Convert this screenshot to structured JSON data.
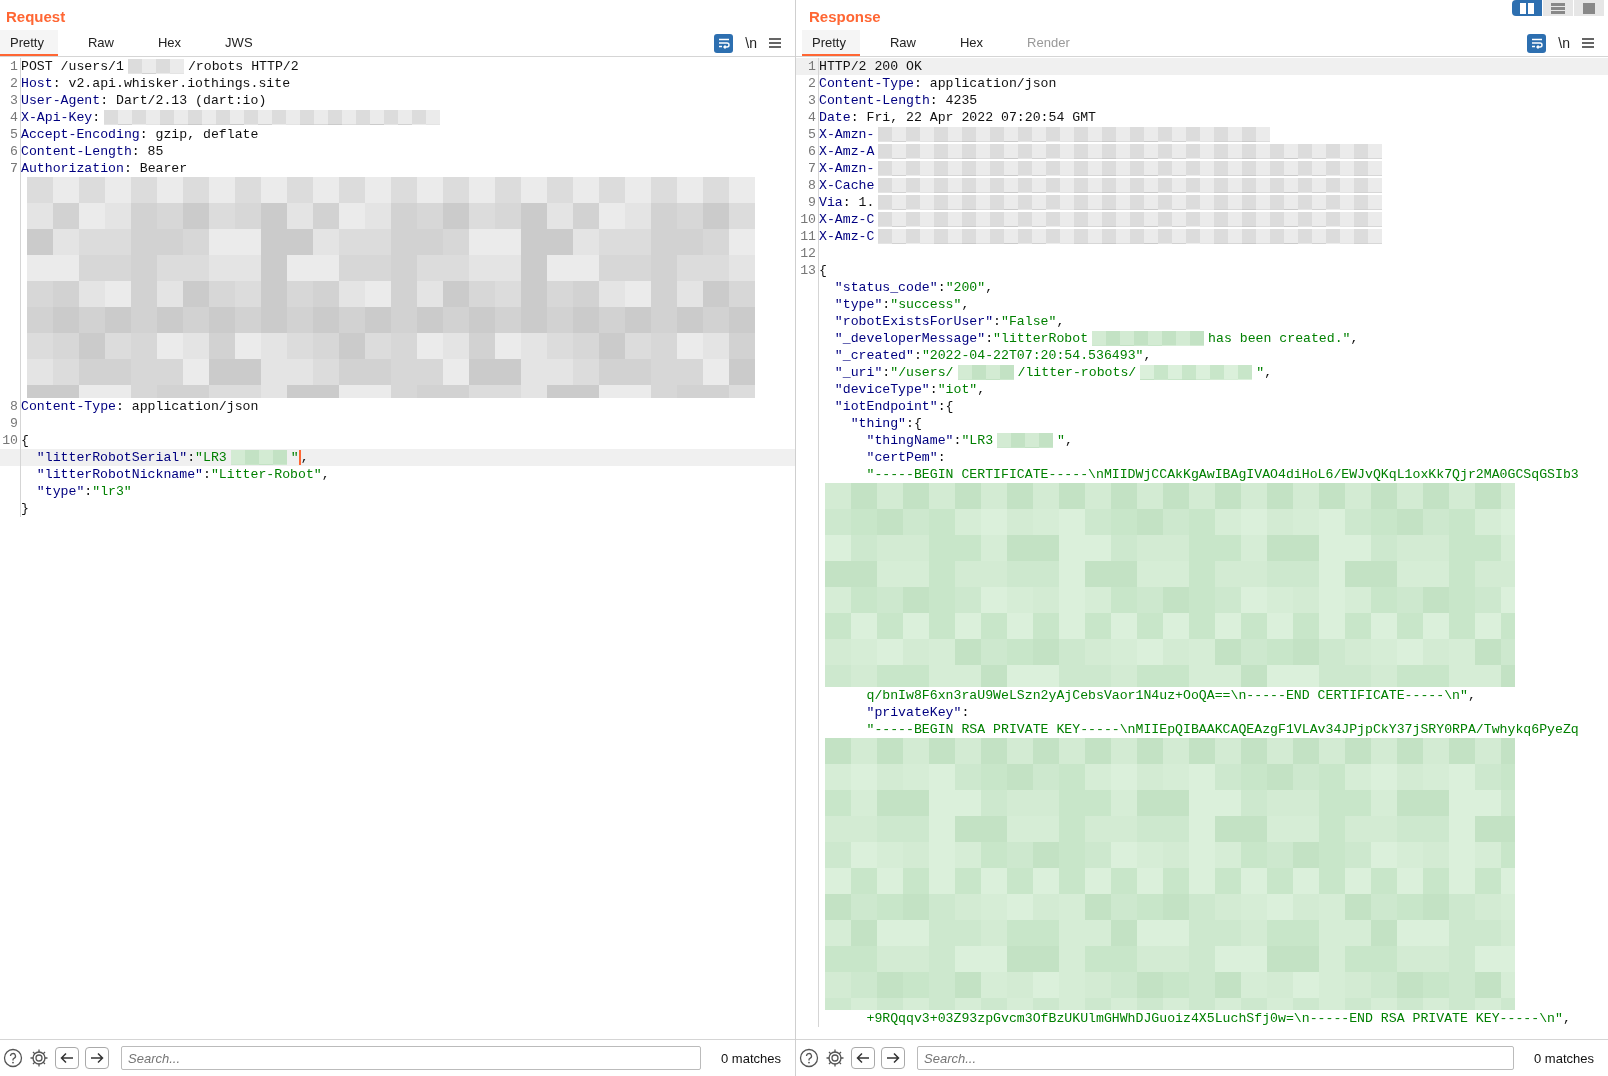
{
  "panels": [
    {
      "title": "Request",
      "tabs": [
        {
          "label": "Pretty",
          "selected": true,
          "disabled": false
        },
        {
          "label": "Raw",
          "selected": false,
          "disabled": false
        },
        {
          "label": "Hex",
          "selected": false,
          "disabled": false
        },
        {
          "label": "JWS",
          "selected": false,
          "disabled": false
        }
      ],
      "toolbar": {
        "wrap_on": true,
        "newline_label": "\\n"
      },
      "lines": [
        {
          "kind": "root",
          "num": "1",
          "current": false,
          "parts": [
            {
              "kind": "text",
              "text": "POST /users/1"
            },
            {
              "kind": "blur"
            },
            {
              "kind": "text",
              "text": "/robots HTTP/2"
            }
          ]
        },
        {
          "kind": "root",
          "num": "2",
          "current": false,
          "parts": [
            {
              "kind": "key",
              "text": "Host"
            },
            {
              "kind": "text",
              "text": ": v2.api.whisker.iothings.site"
            }
          ]
        },
        {
          "kind": "root",
          "num": "3",
          "current": false,
          "parts": [
            {
              "kind": "key",
              "text": "User-Agent"
            },
            {
              "kind": "text",
              "text": ": Dart/2.13 (dart:io)"
            }
          ]
        },
        {
          "kind": "root",
          "num": "4",
          "current": false,
          "parts": [
            {
              "kind": "key",
              "text": "X-Api-Key"
            },
            {
              "kind": "text",
              "text": ":"
            },
            {
              "kind": "blur"
            },
            {
              "kind": "blur"
            },
            {
              "kind": "blur"
            },
            {
              "kind": "blur"
            },
            {
              "kind": "blur"
            },
            {
              "kind": "blur"
            }
          ]
        },
        {
          "kind": "root",
          "num": "5",
          "current": false,
          "parts": [
            {
              "kind": "key",
              "text": "Accept-Encoding"
            },
            {
              "kind": "text",
              "text": ": gzip, deflate"
            }
          ]
        },
        {
          "kind": "root",
          "num": "6",
          "current": false,
          "parts": [
            {
              "kind": "key",
              "text": "Content-Length"
            },
            {
              "kind": "text",
              "text": ": 85"
            }
          ]
        },
        {
          "kind": "root",
          "num": "7",
          "current": false,
          "parts": [
            {
              "kind": "key",
              "text": "Authorization"
            },
            {
              "kind": "text",
              "text": ": Bearer"
            }
          ]
        },
        {
          "kind": "hidden"
        },
        {
          "kind": "hidden"
        },
        {
          "kind": "hidden"
        },
        {
          "kind": "hidden"
        },
        {
          "kind": "hidden"
        },
        {
          "kind": "hidden"
        },
        {
          "kind": "hidden"
        },
        {
          "kind": "hidden"
        },
        {
          "kind": "hidden"
        },
        {
          "kind": "hidden"
        },
        {
          "kind": "hidden"
        },
        {
          "kind": "hidden"
        },
        {
          "kind": "hidden"
        },
        {
          "kind": "root",
          "num": "8",
          "current": false,
          "parts": [
            {
              "kind": "key",
              "text": "Content-Type"
            },
            {
              "kind": "text",
              "text": ": application/json"
            }
          ]
        },
        {
          "kind": "root",
          "num": "9",
          "current": false
        },
        {
          "kind": "root",
          "num": "10",
          "current": false,
          "parts": [
            {
              "kind": "text",
              "text": "{"
            }
          ]
        },
        {
          "kind": "member",
          "current": true,
          "parts": [
            {
              "kind": "key",
              "text": "\"litterRobotSerial\""
            },
            {
              "kind": "text",
              "text": ":"
            },
            {
              "kind": "str",
              "text": "\"LR3"
            },
            {
              "kind": "blur"
            },
            {
              "kind": "str",
              "text": "\""
            },
            {
              "kind": "caret"
            },
            {
              "kind": "text",
              "text": ","
            }
          ]
        },
        {
          "kind": "member",
          "current": false,
          "parts": [
            {
              "kind": "key",
              "text": "\"litterRobotNickname\""
            },
            {
              "kind": "text",
              "text": ":"
            },
            {
              "kind": "str",
              "text": "\"Litter-Robot\""
            },
            {
              "kind": "text",
              "text": ","
            }
          ]
        },
        {
          "kind": "member",
          "current": false,
          "parts": [
            {
              "kind": "key",
              "text": "\"type\""
            },
            {
              "kind": "text",
              "text": ":"
            },
            {
              "kind": "str",
              "text": "\"lr3\""
            }
          ]
        },
        {
          "kind": "root",
          "current": false,
          "parts": [
            {
              "kind": "text",
              "text": "}"
            }
          ]
        }
      ],
      "search": {
        "placeholder": "Search..."
      },
      "matches": "0 matches"
    },
    {
      "title": "Response",
      "layout_buttons": [
        {
          "kind": "split",
          "selected": true
        },
        {
          "kind": "stack",
          "selected": false
        },
        {
          "kind": "single",
          "selected": false
        }
      ],
      "tabs": [
        {
          "label": "Pretty",
          "selected": true,
          "disabled": false
        },
        {
          "label": "Raw",
          "selected": false,
          "disabled": false
        },
        {
          "label": "Hex",
          "selected": false,
          "disabled": false
        },
        {
          "label": "Render",
          "selected": false,
          "disabled": true
        }
      ],
      "toolbar": {
        "wrap_on": true,
        "newline_label": "\\n"
      },
      "lines": [
        {
          "kind": "root",
          "num": "1",
          "current": true,
          "parts": [
            {
              "kind": "text",
              "text": "HTTP/2 200 OK"
            }
          ]
        },
        {
          "kind": "root",
          "num": "2",
          "current": false,
          "parts": [
            {
              "kind": "key",
              "text": "Content-Type"
            },
            {
              "kind": "text",
              "text": ": application/json"
            }
          ]
        },
        {
          "kind": "root",
          "num": "3",
          "current": false,
          "parts": [
            {
              "kind": "key",
              "text": "Content-Length"
            },
            {
              "kind": "text",
              "text": ": 4235"
            }
          ]
        },
        {
          "kind": "root",
          "num": "4",
          "current": false,
          "parts": [
            {
              "kind": "key",
              "text": "Date"
            },
            {
              "kind": "text",
              "text": ": Fri, 22 Apr 2022 07:20:54 GMT"
            }
          ]
        },
        {
          "kind": "root",
          "num": "5",
          "current": false,
          "parts": [
            {
              "kind": "key",
              "text": "X-Amzn-"
            },
            {
              "kind": "blur"
            },
            {
              "kind": "blur"
            },
            {
              "kind": "blur"
            },
            {
              "kind": "blur"
            },
            {
              "kind": "blur"
            },
            {
              "kind": "blur"
            },
            {
              "kind": "blur"
            }
          ]
        },
        {
          "kind": "root",
          "num": "6",
          "current": false,
          "parts": [
            {
              "kind": "key",
              "text": "X-Amz-A"
            },
            {
              "kind": "blur"
            },
            {
              "kind": "blur"
            },
            {
              "kind": "blur"
            },
            {
              "kind": "blur"
            },
            {
              "kind": "blur"
            },
            {
              "kind": "blur"
            },
            {
              "kind": "blur"
            },
            {
              "kind": "blur"
            },
            {
              "kind": "blur"
            }
          ]
        },
        {
          "kind": "root",
          "num": "7",
          "current": false,
          "parts": [
            {
              "kind": "key",
              "text": "X-Amzn-"
            },
            {
              "kind": "blur"
            },
            {
              "kind": "blur"
            },
            {
              "kind": "blur"
            },
            {
              "kind": "blur"
            },
            {
              "kind": "blur"
            },
            {
              "kind": "blur"
            },
            {
              "kind": "blur"
            },
            {
              "kind": "blur"
            },
            {
              "kind": "blur"
            }
          ]
        },
        {
          "kind": "root",
          "num": "8",
          "current": false,
          "parts": [
            {
              "kind": "key",
              "text": "X-Cache"
            },
            {
              "kind": "blur"
            },
            {
              "kind": "blur"
            },
            {
              "kind": "blur"
            },
            {
              "kind": "blur"
            },
            {
              "kind": "blur"
            },
            {
              "kind": "blur"
            },
            {
              "kind": "blur"
            },
            {
              "kind": "blur"
            },
            {
              "kind": "blur"
            }
          ]
        },
        {
          "kind": "root",
          "num": "9",
          "current": false,
          "parts": [
            {
              "kind": "key",
              "text": "Via"
            },
            {
              "kind": "text",
              "text": ": 1."
            },
            {
              "kind": "blur"
            },
            {
              "kind": "blur"
            },
            {
              "kind": "blur"
            },
            {
              "kind": "blur"
            },
            {
              "kind": "blur"
            },
            {
              "kind": "blur"
            },
            {
              "kind": "blur"
            },
            {
              "kind": "blur"
            },
            {
              "kind": "blur"
            }
          ]
        },
        {
          "kind": "root",
          "num": "10",
          "current": false,
          "parts": [
            {
              "kind": "key",
              "text": "X-Amz-C"
            },
            {
              "kind": "blur"
            },
            {
              "kind": "blur"
            },
            {
              "kind": "blur"
            },
            {
              "kind": "blur"
            },
            {
              "kind": "blur"
            },
            {
              "kind": "blur"
            },
            {
              "kind": "blur"
            },
            {
              "kind": "blur"
            },
            {
              "kind": "blur"
            }
          ]
        },
        {
          "kind": "root",
          "num": "11",
          "current": false,
          "parts": [
            {
              "kind": "key",
              "text": "X-Amz-C"
            },
            {
              "kind": "blur"
            },
            {
              "kind": "blur"
            },
            {
              "kind": "blur"
            },
            {
              "kind": "blur"
            },
            {
              "kind": "blur"
            },
            {
              "kind": "blur"
            },
            {
              "kind": "blur"
            },
            {
              "kind": "blur"
            },
            {
              "kind": "blur"
            }
          ]
        },
        {
          "kind": "root",
          "num": "12",
          "current": false
        },
        {
          "kind": "root",
          "num": "13",
          "current": false,
          "parts": [
            {
              "kind": "text",
              "text": "{"
            }
          ]
        },
        {
          "kind": "member",
          "current": false,
          "parts": [
            {
              "kind": "key",
              "text": "\"status_code\""
            },
            {
              "kind": "text",
              "text": ":"
            },
            {
              "kind": "str",
              "text": "\"200\""
            },
            {
              "kind": "text",
              "text": ","
            }
          ]
        },
        {
          "kind": "member",
          "current": false,
          "parts": [
            {
              "kind": "key",
              "text": "\"type\""
            },
            {
              "kind": "text",
              "text": ":"
            },
            {
              "kind": "str",
              "text": "\"success\""
            },
            {
              "kind": "text",
              "text": ","
            }
          ]
        },
        {
          "kind": "member",
          "current": false,
          "parts": [
            {
              "kind": "key",
              "text": "\"robotExistsForUser\""
            },
            {
              "kind": "text",
              "text": ":"
            },
            {
              "kind": "str",
              "text": "\"False\""
            },
            {
              "kind": "text",
              "text": ","
            }
          ]
        },
        {
          "kind": "member",
          "current": false,
          "parts": [
            {
              "kind": "key",
              "text": "\"_developerMessage\""
            },
            {
              "kind": "text",
              "text": ":"
            },
            {
              "kind": "str",
              "text": "\"litterRobot"
            },
            {
              "kind": "blur"
            },
            {
              "kind": "blur"
            },
            {
              "kind": "str",
              "text": "has been created.\""
            },
            {
              "kind": "text",
              "text": ","
            }
          ]
        },
        {
          "kind": "member",
          "current": false,
          "parts": [
            {
              "kind": "key",
              "text": "\"_created\""
            },
            {
              "kind": "text",
              "text": ":"
            },
            {
              "kind": "str",
              "text": "\"2022-04-22T07:20:54.536493\""
            },
            {
              "kind": "text",
              "text": ","
            }
          ]
        },
        {
          "kind": "member",
          "current": false,
          "parts": [
            {
              "kind": "key",
              "text": "\"_uri\""
            },
            {
              "kind": "text",
              "text": ":"
            },
            {
              "kind": "str",
              "text": "\"/users/"
            },
            {
              "kind": "blur"
            },
            {
              "kind": "str",
              "text": "/litter-robots/"
            },
            {
              "kind": "blur"
            },
            {
              "kind": "blur"
            },
            {
              "kind": "str",
              "text": "\""
            },
            {
              "kind": "text",
              "text": ","
            }
          ]
        },
        {
          "kind": "member",
          "current": false,
          "parts": [
            {
              "kind": "key",
              "text": "\"deviceType\""
            },
            {
              "kind": "text",
              "text": ":"
            },
            {
              "kind": "str",
              "text": "\"iot\""
            },
            {
              "kind": "text",
              "text": ","
            }
          ]
        },
        {
          "kind": "member",
          "current": false,
          "parts": [
            {
              "kind": "key",
              "text": "\"iotEndpoint\""
            },
            {
              "kind": "text",
              "text": ":{"
            }
          ]
        },
        {
          "kind": "nested",
          "current": false,
          "parts": [
            {
              "kind": "key",
              "text": "\"thing\""
            },
            {
              "kind": "text",
              "text": ":{"
            }
          ]
        },
        {
          "kind": "deep",
          "current": false,
          "parts": [
            {
              "kind": "key",
              "text": "\"thingName\""
            },
            {
              "kind": "text",
              "text": ":"
            },
            {
              "kind": "str",
              "text": "\"LR3"
            },
            {
              "kind": "blur"
            },
            {
              "kind": "str",
              "text": "\""
            },
            {
              "kind": "text",
              "text": ","
            }
          ]
        },
        {
          "kind": "deep",
          "current": false,
          "parts": [
            {
              "kind": "key",
              "text": "\"certPem\""
            },
            {
              "kind": "text",
              "text": ":"
            }
          ]
        },
        {
          "kind": "deep",
          "current": false,
          "parts": [
            {
              "kind": "str",
              "text": "\"-----BEGIN CERTIFICATE-----\\nMIIDWjCCAkKgAwIBAgIVAO4diHoL6/EWJvQKqL1oxKk7Qjr2MA0GCSqGSIb3"
            }
          ]
        },
        {
          "kind": "hidden"
        },
        {
          "kind": "hidden"
        },
        {
          "kind": "hidden"
        },
        {
          "kind": "hidden"
        },
        {
          "kind": "hidden"
        },
        {
          "kind": "hidden"
        },
        {
          "kind": "hidden"
        },
        {
          "kind": "hidden"
        },
        {
          "kind": "hidden"
        },
        {
          "kind": "hidden"
        },
        {
          "kind": "hidden"
        },
        {
          "kind": "hidden"
        },
        {
          "kind": "deep",
          "current": false,
          "parts": [
            {
              "kind": "str",
              "text": "q/bnIw8F6xn3raU9WeLSzn2yAjCebsVaor1N4uz+OoQA==\\n-----END CERTIFICATE-----\\n\""
            },
            {
              "kind": "text",
              "text": ","
            }
          ]
        },
        {
          "kind": "deep",
          "current": false,
          "parts": [
            {
              "kind": "key",
              "text": "\"privateKey\""
            },
            {
              "kind": "text",
              "text": ":"
            }
          ]
        },
        {
          "kind": "deep",
          "current": false,
          "parts": [
            {
              "kind": "str",
              "text": "\"-----BEGIN RSA PRIVATE KEY-----\\nMIIEpQIBAAKCAQEAzgF1VLAv34JPjpCkY37jSRY0RPA/Twhykq6PyeZq"
            }
          ]
        },
        {
          "kind": "hidden"
        },
        {
          "kind": "hidden"
        },
        {
          "kind": "hidden"
        },
        {
          "kind": "hidden"
        },
        {
          "kind": "hidden"
        },
        {
          "kind": "hidden"
        },
        {
          "kind": "hidden"
        },
        {
          "kind": "hidden"
        },
        {
          "kind": "hidden"
        },
        {
          "kind": "hidden"
        },
        {
          "kind": "hidden"
        },
        {
          "kind": "hidden"
        },
        {
          "kind": "hidden"
        },
        {
          "kind": "hidden"
        },
        {
          "kind": "hidden"
        },
        {
          "kind": "hidden"
        },
        {
          "kind": "deep",
          "current": false,
          "parts": [
            {
              "kind": "str",
              "text": "+9RQqqv3+03Z93zpGvcm3OfBzUKUlmGHWhDJGuoiz4X5LuchSfj0w=\\n-----END RSA PRIVATE KEY-----\\n\""
            },
            {
              "kind": "text",
              "text": ","
            }
          ]
        }
      ],
      "search": {
        "placeholder": "Search..."
      },
      "matches": "0 matches"
    }
  ]
}
